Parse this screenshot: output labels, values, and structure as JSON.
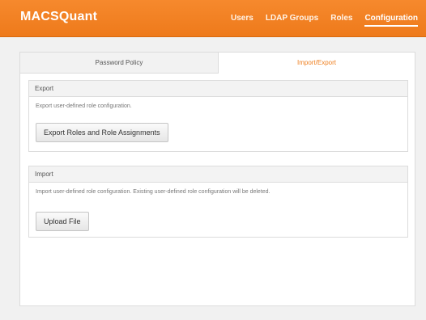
{
  "app": {
    "title": "MACSQuant"
  },
  "nav": {
    "items": [
      {
        "label": "Users"
      },
      {
        "label": "LDAP Groups"
      },
      {
        "label": "Roles"
      },
      {
        "label": "Configuration"
      }
    ],
    "active": "Configuration"
  },
  "tabs": [
    {
      "label": "Password Policy"
    },
    {
      "label": "Import/Export"
    }
  ],
  "colors": {
    "brand": "#f6892d",
    "active_tab": "#ef7f1f"
  },
  "export": {
    "heading": "Export",
    "description": "Export user-defined role configuration.",
    "button_label": "Export Roles and Role Assignments"
  },
  "import": {
    "heading": "Import",
    "description": "Import user-defined role configuration. Existing user-defined role configuration will be deleted.",
    "button_label": "Upload File"
  }
}
